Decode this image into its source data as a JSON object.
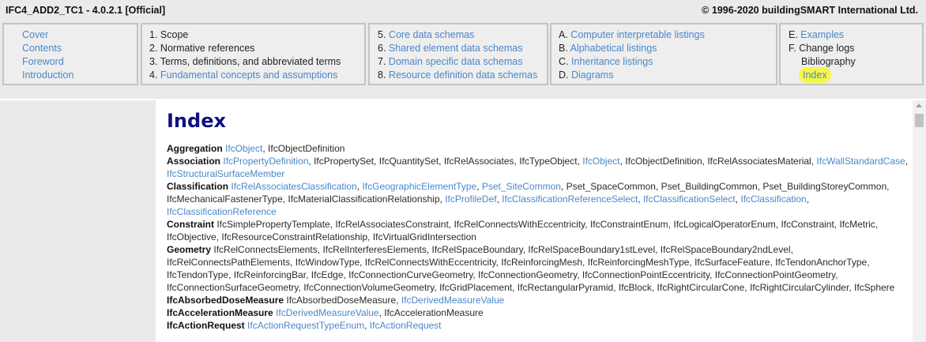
{
  "header": {
    "title": "IFC4_ADD2_TC1 - 4.0.2.1 [Official]",
    "copyright": "© 1996-2020 buildingSMART International Ltd."
  },
  "nav": {
    "box1": [
      {
        "label": "Cover",
        "link": true
      },
      {
        "label": "Contents",
        "link": true
      },
      {
        "label": "Foreword",
        "link": true
      },
      {
        "label": "Introduction",
        "link": true
      }
    ],
    "box2": [
      {
        "num": "1.",
        "label": "Scope",
        "link": false
      },
      {
        "num": "2.",
        "label": "Normative references",
        "link": false
      },
      {
        "num": "3.",
        "label": "Terms, definitions, and abbreviated terms",
        "link": false
      },
      {
        "num": "4.",
        "label": "Fundamental concepts and assumptions",
        "link": true
      }
    ],
    "box3": [
      {
        "num": "5.",
        "label": "Core data schemas",
        "link": true
      },
      {
        "num": "6.",
        "label": "Shared element data schemas",
        "link": true
      },
      {
        "num": "7.",
        "label": "Domain specific data schemas",
        "link": true
      },
      {
        "num": "8.",
        "label": "Resource definition data schemas",
        "link": true
      }
    ],
    "box4": [
      {
        "num": "A.",
        "label": "Computer interpretable listings",
        "link": true
      },
      {
        "num": "B.",
        "label": "Alphabetical listings",
        "link": true
      },
      {
        "num": "C.",
        "label": "Inheritance listings",
        "link": true
      },
      {
        "num": "D.",
        "label": "Diagrams",
        "link": true
      }
    ],
    "box5": [
      {
        "num": "E.",
        "label": "Examples",
        "link": true
      },
      {
        "num": "F.",
        "label": "Change logs",
        "link": false
      },
      {
        "num": "",
        "label": "Bibliography",
        "link": false
      },
      {
        "num": "",
        "label": "Index",
        "link": true,
        "highlighted": true
      }
    ]
  },
  "page": {
    "heading": "Index"
  },
  "colors": {
    "link": "#4a87c9",
    "heading": "#101080",
    "highlight": "#f6f64a"
  },
  "index_entries": [
    {
      "term": "Aggregation",
      "refs": [
        {
          "t": "IfcObject",
          "l": true
        },
        {
          "t": "IfcObjectDefinition",
          "l": false
        }
      ]
    },
    {
      "term": "Association",
      "refs": [
        {
          "t": "IfcPropertyDefinition",
          "l": true
        },
        {
          "t": "IfcPropertySet",
          "l": false
        },
        {
          "t": "IfcQuantitySet",
          "l": false
        },
        {
          "t": "IfcRelAssociates",
          "l": false
        },
        {
          "t": "IfcTypeObject",
          "l": false
        },
        {
          "t": "IfcObject",
          "l": true
        },
        {
          "t": "IfcObjectDefinition",
          "l": false
        },
        {
          "t": "IfcRelAssociatesMaterial",
          "l": false
        },
        {
          "t": "IfcWallStandardCase",
          "l": true
        },
        {
          "t": "IfcStructuralSurfaceMember",
          "l": true
        }
      ]
    },
    {
      "term": "Classification",
      "refs": [
        {
          "t": "IfcRelAssociatesClassification",
          "l": true
        },
        {
          "t": "IfcGeographicElementType",
          "l": true
        },
        {
          "t": "Pset_SiteCommon",
          "l": true
        },
        {
          "t": "Pset_SpaceCommon",
          "l": false
        },
        {
          "t": "Pset_BuildingCommon",
          "l": false
        },
        {
          "t": "Pset_BuildingStoreyCommon",
          "l": false
        },
        {
          "t": "IfcMechanicalFastenerType",
          "l": false
        },
        {
          "t": "IfcMaterialClassificationRelationship",
          "l": false
        },
        {
          "t": "IfcProfileDef",
          "l": true
        },
        {
          "t": "IfcClassificationReferenceSelect",
          "l": true
        },
        {
          "t": "IfcClassificationSelect",
          "l": true
        },
        {
          "t": "IfcClassification",
          "l": true
        },
        {
          "t": "IfcClassificationReference",
          "l": true
        }
      ]
    },
    {
      "term": "Constraint",
      "refs": [
        {
          "t": "IfcSimplePropertyTemplate",
          "l": false
        },
        {
          "t": "IfcRelAssociatesConstraint",
          "l": false
        },
        {
          "t": "IfcRelConnectsWithEccentricity",
          "l": false
        },
        {
          "t": "IfcConstraintEnum",
          "l": false
        },
        {
          "t": "IfcLogicalOperatorEnum",
          "l": false
        },
        {
          "t": "IfcConstraint",
          "l": false
        },
        {
          "t": "IfcMetric",
          "l": false
        },
        {
          "t": "IfcObjective",
          "l": false
        },
        {
          "t": "IfcResourceConstraintRelationship",
          "l": false
        },
        {
          "t": "IfcVirtualGridIntersection",
          "l": false
        }
      ]
    },
    {
      "term": "Geometry",
      "refs": [
        {
          "t": "IfcRelConnectsElements",
          "l": false
        },
        {
          "t": "IfcRelInterferesElements",
          "l": false
        },
        {
          "t": "IfcRelSpaceBoundary",
          "l": false
        },
        {
          "t": "IfcRelSpaceBoundary1stLevel",
          "l": false
        },
        {
          "t": "IfcRelSpaceBoundary2ndLevel",
          "l": false
        },
        {
          "t": "IfcRelConnectsPathElements",
          "l": false
        },
        {
          "t": "IfcWindowType",
          "l": false
        },
        {
          "t": "IfcRelConnectsWithEccentricity",
          "l": false
        },
        {
          "t": "IfcReinforcingMesh",
          "l": false
        },
        {
          "t": "IfcReinforcingMeshType",
          "l": false
        },
        {
          "t": "IfcSurfaceFeature",
          "l": false
        },
        {
          "t": "IfcTendonAnchorType",
          "l": false
        },
        {
          "t": "IfcTendonType",
          "l": false
        },
        {
          "t": "IfcReinforcingBar",
          "l": false
        },
        {
          "t": "IfcEdge",
          "l": false
        },
        {
          "t": "IfcConnectionCurveGeometry",
          "l": false
        },
        {
          "t": "IfcConnectionGeometry",
          "l": false
        },
        {
          "t": "IfcConnectionPointEccentricity",
          "l": false
        },
        {
          "t": "IfcConnectionPointGeometry",
          "l": false
        },
        {
          "t": "IfcConnectionSurfaceGeometry",
          "l": false
        },
        {
          "t": "IfcConnectionVolumeGeometry",
          "l": false
        },
        {
          "t": "IfcGridPlacement",
          "l": false
        },
        {
          "t": "IfcRectangularPyramid",
          "l": false
        },
        {
          "t": "IfcBlock",
          "l": false
        },
        {
          "t": "IfcRightCircularCone",
          "l": false
        },
        {
          "t": "IfcRightCircularCylinder",
          "l": false
        },
        {
          "t": "IfcSphere",
          "l": false
        }
      ]
    },
    {
      "term": "IfcAbsorbedDoseMeasure",
      "refs": [
        {
          "t": "IfcAbsorbedDoseMeasure",
          "l": false
        },
        {
          "t": "IfcDerivedMeasureValue",
          "l": true
        }
      ]
    },
    {
      "term": "IfcAccelerationMeasure",
      "refs": [
        {
          "t": "IfcDerivedMeasureValue",
          "l": true
        },
        {
          "t": "IfcAccelerationMeasure",
          "l": false
        }
      ]
    },
    {
      "term": "IfcActionRequest",
      "refs": [
        {
          "t": "IfcActionRequestTypeEnum",
          "l": true
        },
        {
          "t": "IfcActionRequest",
          "l": true
        }
      ]
    }
  ]
}
